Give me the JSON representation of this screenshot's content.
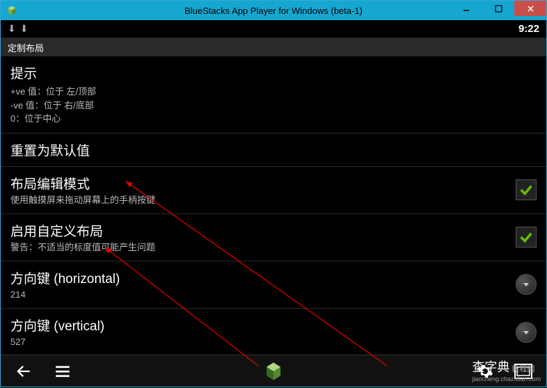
{
  "window": {
    "title": "BlueStacks App Player for Windows (beta-1)"
  },
  "statusbar": {
    "time": "9:22"
  },
  "app": {
    "header": "定制布局"
  },
  "settings": {
    "tips": {
      "title": "提示",
      "line1": "+ve 值：位于 左/顶部",
      "line2": "-ve 值：位于 右/底部",
      "line3": "0：位于中心"
    },
    "reset": {
      "title": "重置为默认值"
    },
    "layout_edit": {
      "title": "布局编辑模式",
      "sub": "使用触摸屏来拖动屏幕上的手柄按键",
      "checked": true
    },
    "custom_layout": {
      "title": "启用自定义布局",
      "sub": "警告：不适当的标度值可能产生问题",
      "checked": true
    },
    "dpad_h": {
      "title": "方向键 (horizontal)",
      "value": "214"
    },
    "dpad_v": {
      "title": "方向键 (vertical)",
      "value": "527"
    }
  },
  "watermark": {
    "main": "查字典",
    "suffix": "教程网",
    "url": "jiaocheng.chazidian.com"
  }
}
